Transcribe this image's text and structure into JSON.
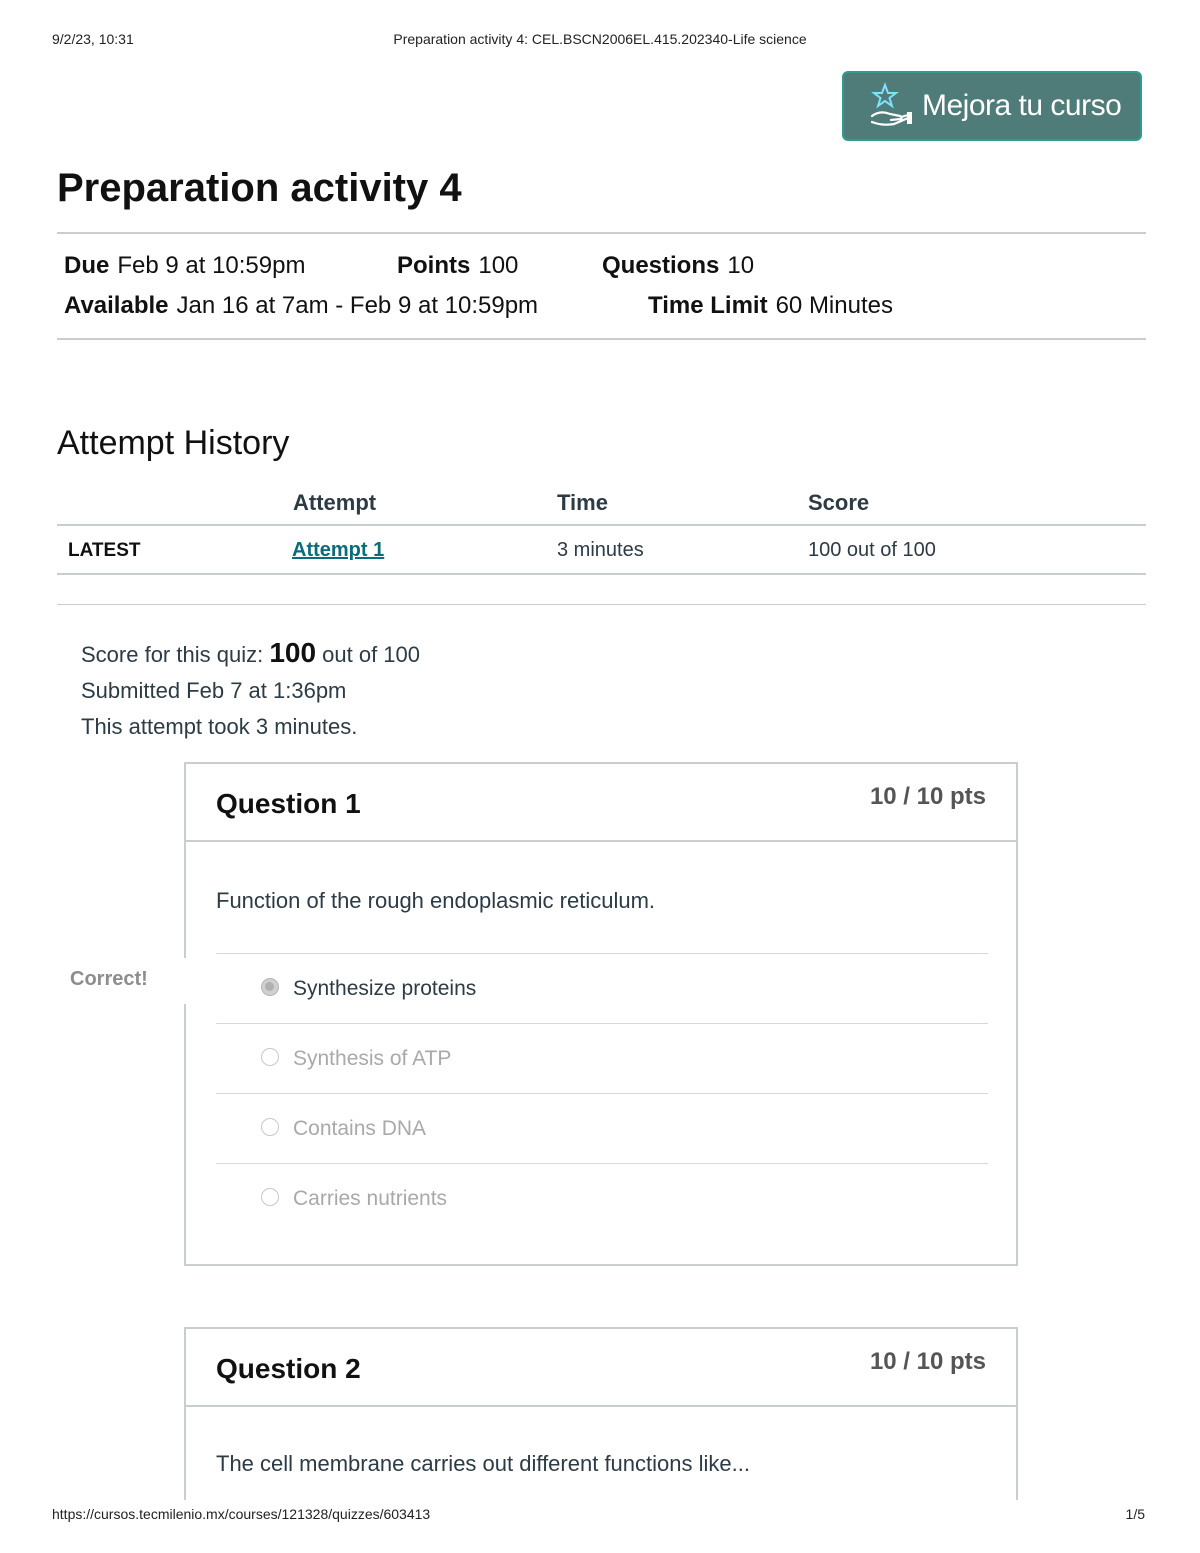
{
  "print_header": {
    "date": "9/2/23, 10:31",
    "title": "Preparation activity 4: CEL.BSCN2006EL.415.202340-Life science"
  },
  "print_footer": {
    "url": "https://cursos.tecmilenio.mx/courses/121328/quizzes/603413",
    "page": "1/5"
  },
  "mejora_button": {
    "label": "Mejora tu curso",
    "icon": "star-hand-icon"
  },
  "quiz": {
    "title": "Preparation activity 4",
    "due_label": "Due",
    "due_value": "Feb 9 at 10:59pm",
    "points_label": "Points",
    "points_value": "100",
    "questions_label": "Questions",
    "questions_value": "10",
    "available_label": "Available",
    "available_value": "Jan 16 at 7am - Feb 9 at 10:59pm",
    "time_limit_label": "Time Limit",
    "time_limit_value": "60 Minutes"
  },
  "attempt_history": {
    "title": "Attempt History",
    "columns": [
      "Attempt",
      "Time",
      "Score"
    ],
    "rows": [
      {
        "tag": "LATEST",
        "attempt": "Attempt 1",
        "time": "3 minutes",
        "score": "100 out of 100"
      }
    ]
  },
  "summary": {
    "score_prefix": "Score for this quiz:",
    "score_value": "100",
    "score_suffix": "out of 100",
    "submitted": "Submitted Feb 7 at 1:36pm",
    "duration": "This attempt took 3 minutes."
  },
  "questions": [
    {
      "title": "Question 1",
      "points": "10 / 10 pts",
      "text": "Function of the rough endoplasmic reticulum.",
      "correct_tag": "Correct!",
      "answers": [
        "Synthesize proteins",
        "Synthesis of ATP",
        "Contains DNA",
        "Carries nutrients"
      ],
      "selected_index": 0
    },
    {
      "title": "Question 2",
      "points": "10 / 10 pts",
      "text": "The cell membrane carries out different functions like..."
    }
  ]
}
